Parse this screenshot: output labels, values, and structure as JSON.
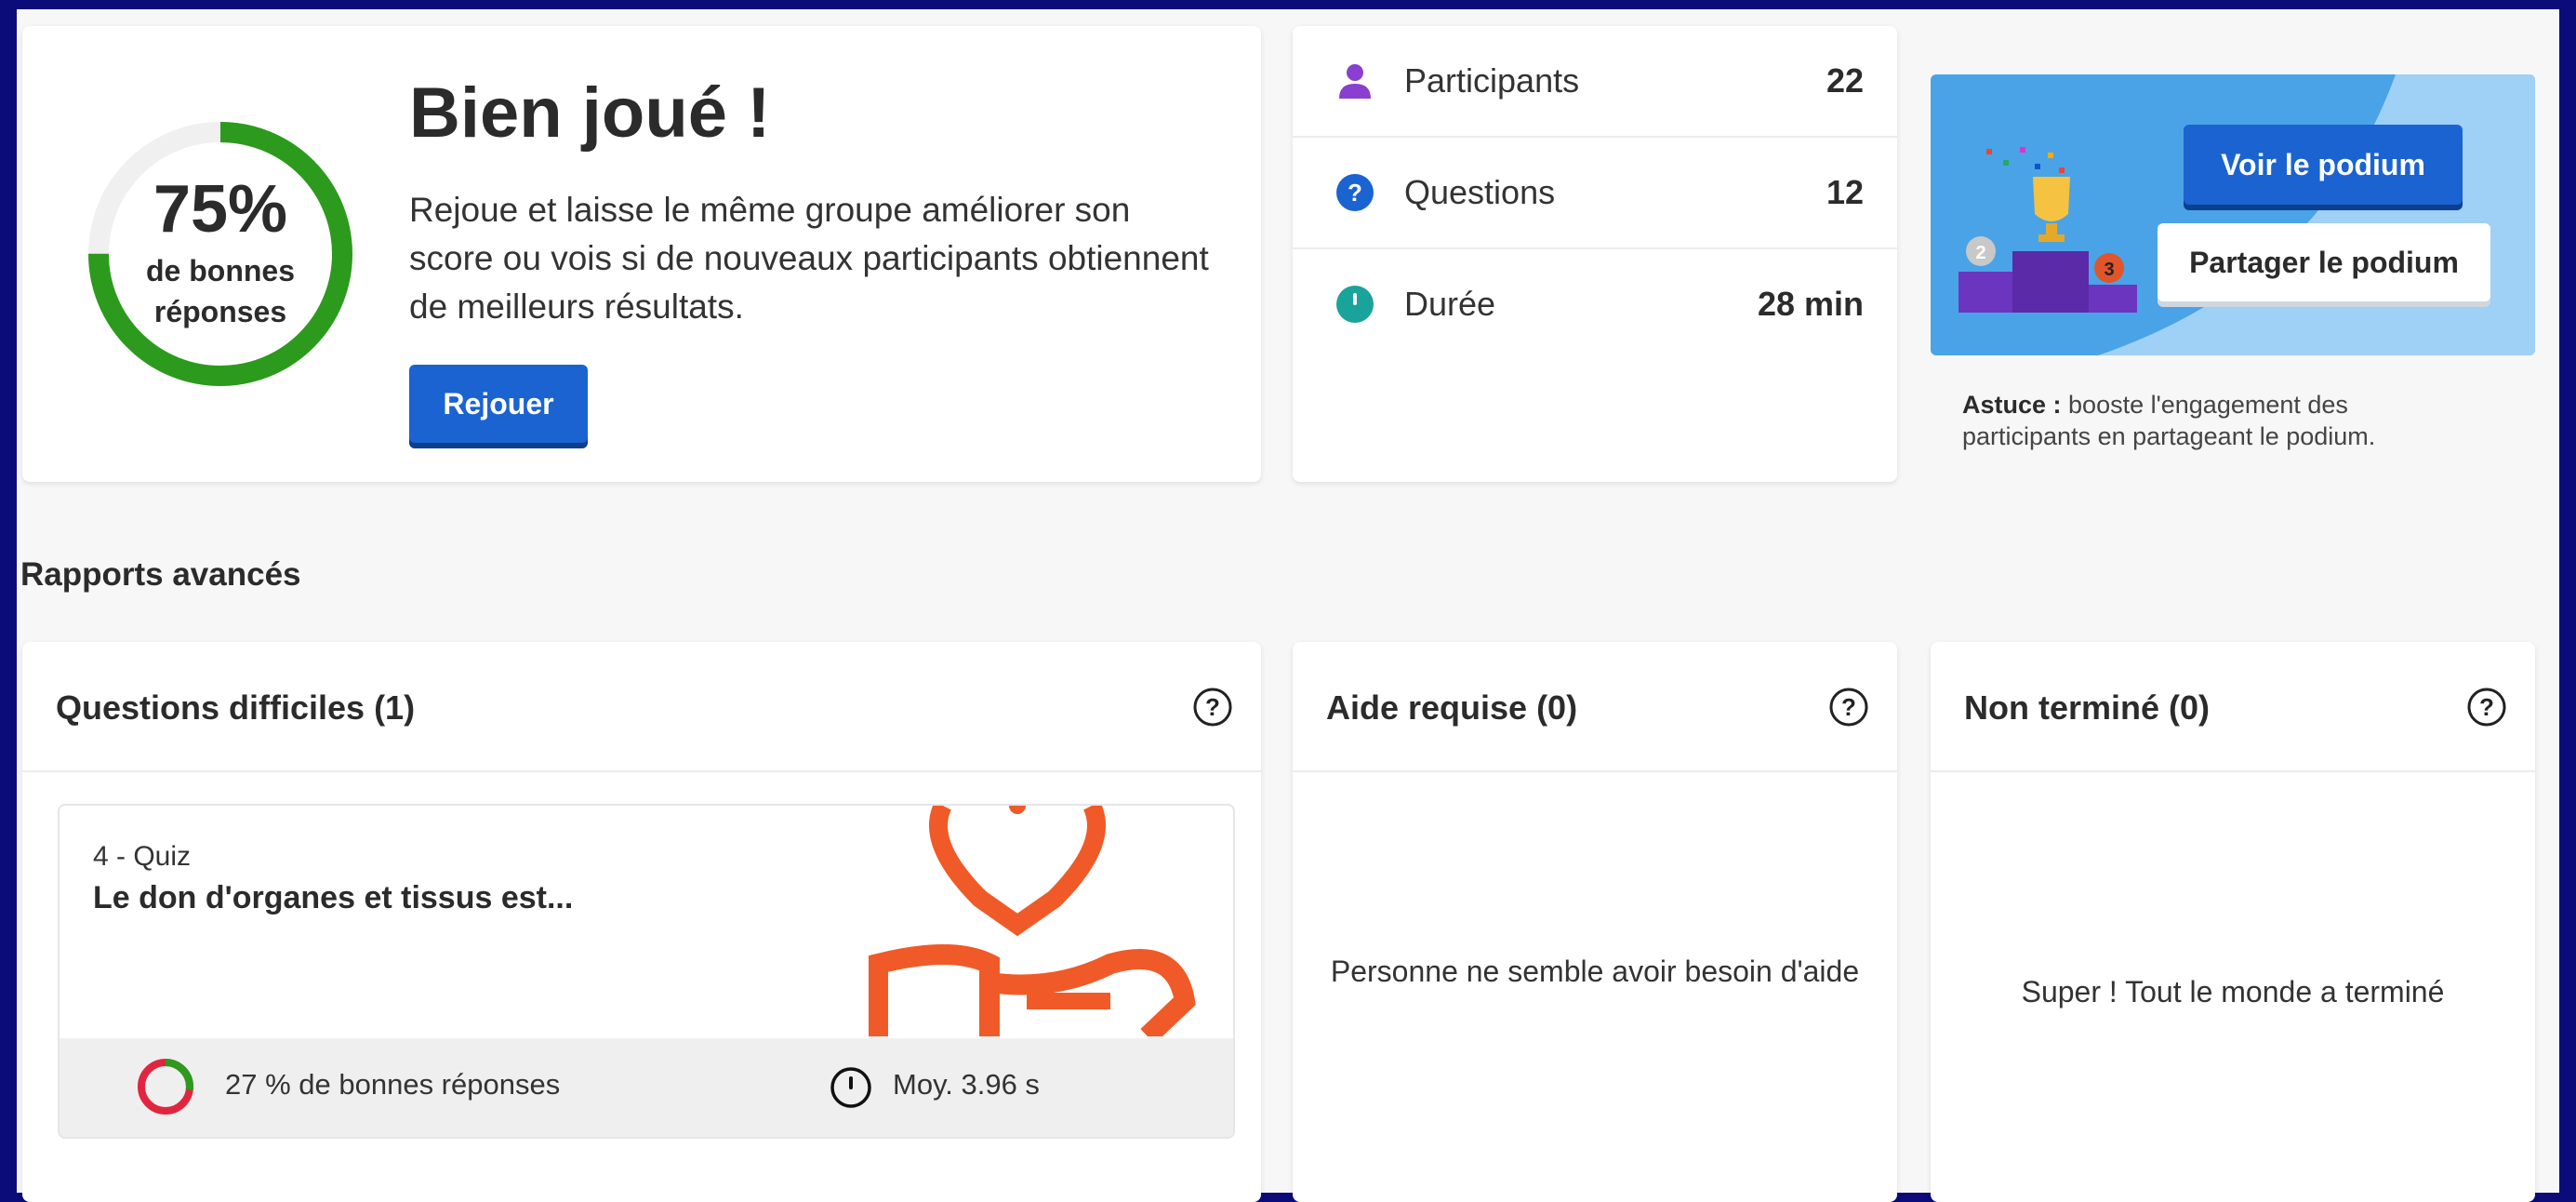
{
  "score": {
    "percent": "75%",
    "percent_value": 75,
    "label": "de bonnes réponses",
    "title": "Bien joué !",
    "description": "Rejoue et laisse le même groupe améliorer son score ou vois si de nouveaux participants obtiennent de meilleurs résultats.",
    "replay_label": "Rejouer"
  },
  "stats": {
    "participants_label": "Participants",
    "participants_value": "22",
    "questions_label": "Questions",
    "questions_value": "12",
    "duration_label": "Durée",
    "duration_value": "28 min"
  },
  "podium": {
    "view_label": "Voir le podium",
    "share_label": "Partager le podium",
    "tip_bold": "Astuce :",
    "tip_text": " booste l'engagement des participants en partageant le podium."
  },
  "section_title": "Rapports avancés",
  "panels": {
    "hard": {
      "title": "Questions difficiles (1)",
      "question_number": "4 - Quiz",
      "question_text": "Le don d'organes et tissus est...",
      "correct_pct_text": "27 % de bonnes réponses",
      "correct_pct_value": 27,
      "avg_time_text": "Moy. 3.96 s"
    },
    "help": {
      "title": "Aide requise (0)",
      "empty_text": "Personne ne semble avoir besoin d'aide"
    },
    "done": {
      "title": "Non terminé (0)",
      "empty_text": "Super ! Tout le monde a terminé"
    }
  },
  "colors": {
    "accent": "#1a63d1",
    "success": "#2c9a1c",
    "danger": "#e0263f",
    "banner": "#4aa3e6"
  }
}
